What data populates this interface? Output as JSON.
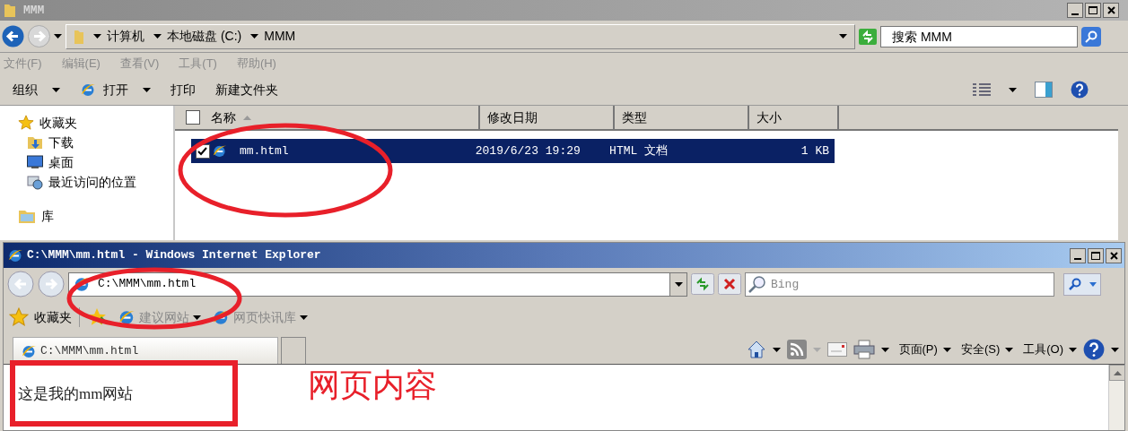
{
  "explorer": {
    "title": "MMM",
    "breadcrumb": [
      "计算机",
      "本地磁盘 (C:)",
      "MMM"
    ],
    "search": {
      "placeholder": "搜索 MMM"
    },
    "menu": [
      "文件(F)",
      "编辑(E)",
      "查看(V)",
      "工具(T)",
      "帮助(H)"
    ],
    "toolbar": [
      {
        "label": "组织",
        "dropdown": true
      },
      {
        "label": "打开",
        "dropdown": true
      },
      {
        "label": "打印",
        "dropdown": false
      },
      {
        "label": "新建文件夹",
        "dropdown": false
      }
    ],
    "sidebar": [
      {
        "label": "收藏夹",
        "children": [
          {
            "label": "下载"
          },
          {
            "label": "桌面"
          },
          {
            "label": "最近访问的位置"
          }
        ]
      },
      {
        "label": "库"
      }
    ],
    "select_all": {
      "checked": false
    },
    "columns": [
      {
        "label": "名称",
        "sorted": true
      },
      {
        "label": "修改日期",
        "sorted": false
      },
      {
        "label": "类型",
        "sorted": false
      },
      {
        "label": "大小",
        "sorted": false
      }
    ],
    "rows": [
      {
        "name": "mm.html",
        "modified": "2019/6/23 19:29",
        "type": "HTML 文档",
        "size": "1 KB",
        "selected": true,
        "checked": true
      }
    ]
  },
  "browser": {
    "title": "C:\\MMM\\mm.html - Windows Internet Explorer",
    "address": "C:\\MMM\\mm.html",
    "search": {
      "placeholder": "Bing"
    },
    "favorites_label": "收藏夹",
    "favorites": [
      {
        "label": "建议网站"
      },
      {
        "label": "网页快讯库"
      }
    ],
    "tab": {
      "label": "C:\\MMM\\mm.html"
    },
    "commands": [
      "页面(P)",
      "安全(S)",
      "工具(O)"
    ],
    "content": "这是我的mm网站"
  },
  "annotations": [
    {
      "kind": "ellipse"
    },
    {
      "kind": "ellipse"
    },
    {
      "kind": "rectangle"
    },
    {
      "kind": "label",
      "text": "网页内容"
    }
  ]
}
